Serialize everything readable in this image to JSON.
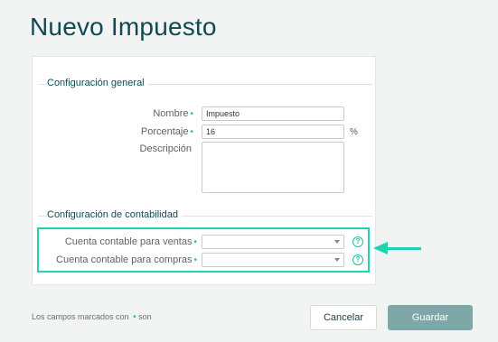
{
  "page": {
    "title": "Nuevo Impuesto"
  },
  "general": {
    "section_title": "Configuración general",
    "name": {
      "label": "Nombre",
      "value": "Impuesto"
    },
    "percentage": {
      "label": "Porcentaje",
      "value": "16",
      "unit": "%"
    },
    "description": {
      "label": "Descripción",
      "value": ""
    }
  },
  "accounting": {
    "section_title": "Configuración de contabilidad",
    "sales_account": {
      "label": "Cuenta contable para ventas",
      "value": "",
      "help_icon": "help-icon"
    },
    "purchases_account": {
      "label": "Cuenta contable para compras",
      "value": "",
      "help_icon": "help-icon"
    }
  },
  "footer": {
    "required_note_prefix": "Los campos marcados con",
    "required_note_suffix": "son",
    "cancel_label": "Cancelar",
    "save_label": "Guardar"
  },
  "required_mark": "•",
  "help_mark": "?",
  "colors": {
    "accent": "#1dbfa4",
    "highlight": "#1dd3b0",
    "title": "#0f4a52",
    "save_button": "#7ea7a7"
  }
}
